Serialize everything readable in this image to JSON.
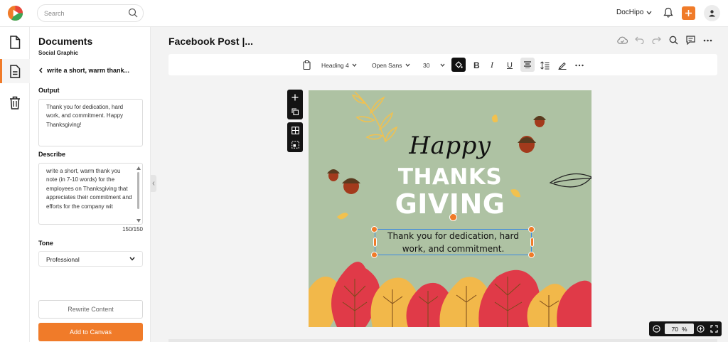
{
  "search": {
    "placeholder": "Search"
  },
  "header": {
    "brand": "DocHipo"
  },
  "panel": {
    "title": "Documents",
    "subtitle": "Social Graphic",
    "back_label": "write a short, warm thank...",
    "output_label": "Output",
    "output_text": "Thank you for dedication, hard work, and commitment. Happy Thanksgiving!",
    "describe_label": "Describe",
    "describe_text": "write a short, warm thank you note (in 7-10 words) for the employees on Thanksgiving that appreciates their commitment and efforts for the company wit",
    "char_count": "150/150",
    "tone_label": "Tone",
    "tone_value": "Professional",
    "rewrite_label": "Rewrite Content",
    "add_label": "Add to Canvas"
  },
  "document": {
    "title": "Facebook Post |..."
  },
  "toolbar": {
    "heading": "Heading 4",
    "font": "Open Sans",
    "size": "30",
    "bold": "B",
    "italic": "I",
    "underline": "U"
  },
  "canvas": {
    "happy": "Happy",
    "thanks": "THANKS",
    "giving": "GIVING",
    "message": "Thank you for dedication, hard work, and commitment."
  },
  "zoom": {
    "value": "70",
    "unit": "%"
  },
  "colors": {
    "accent": "#f07b29",
    "canvas_bg": "#aec2a3",
    "selection": "#3d8ae0",
    "leaf_red": "#e03a48",
    "leaf_yellow": "#f2b84a",
    "acorn": "#a33a1c"
  },
  "icons": {
    "search": "search-icon",
    "bell": "bell-icon",
    "plus": "plus-icon",
    "user": "user-icon"
  }
}
